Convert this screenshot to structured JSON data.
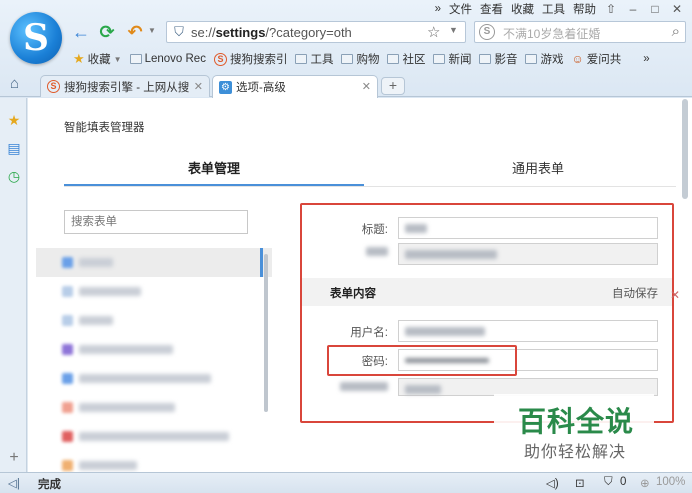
{
  "browser": {
    "menu": [
      "»",
      "文件",
      "查看",
      "收藏",
      "工具",
      "帮助"
    ],
    "window_controls": [
      "⇧",
      "–",
      "□",
      "✕"
    ],
    "address": {
      "scheme": "se://",
      "host": "settings",
      "path": "/?category=oth"
    },
    "search_placeholder": "不满10岁急着征婚",
    "bookmarks": [
      {
        "label": "收藏",
        "icon": "star-icon"
      },
      {
        "label": "Lenovo Rec",
        "icon": "folder-icon"
      },
      {
        "label": "搜狗搜索引",
        "icon": "sogou-icon"
      },
      {
        "label": "工具",
        "icon": "folder-icon"
      },
      {
        "label": "购物",
        "icon": "folder-icon"
      },
      {
        "label": "社区",
        "icon": "folder-icon"
      },
      {
        "label": "新闻",
        "icon": "folder-icon"
      },
      {
        "label": "影音",
        "icon": "folder-icon"
      },
      {
        "label": "游戏",
        "icon": "folder-icon"
      },
      {
        "label": "爱问共",
        "icon": "person-icon"
      }
    ],
    "bookmarks_more": "»",
    "tabs": [
      {
        "label": "搜狗搜索引擎 - 上网从搜",
        "active": false
      },
      {
        "label": "选项-高级",
        "active": true
      }
    ],
    "new_tab": "+"
  },
  "settings": {
    "page_title": "智能填表管理器",
    "tab_form": "表单管理",
    "tab_general": "通用表单",
    "search_placeholder": "搜索表单",
    "fields": {
      "title_label": "标题:",
      "section_title": "表单内容",
      "auto_save": "自动保存",
      "username_label": "用户名:",
      "password_label": "密码:"
    }
  },
  "watermark": {
    "line1": "百科全说",
    "line2": "助你轻松解决"
  },
  "status": {
    "text": "完成",
    "counter": "0",
    "zoom": "100%"
  },
  "colors": {
    "highlight": "#d9463b",
    "accent": "#4a90d9"
  }
}
